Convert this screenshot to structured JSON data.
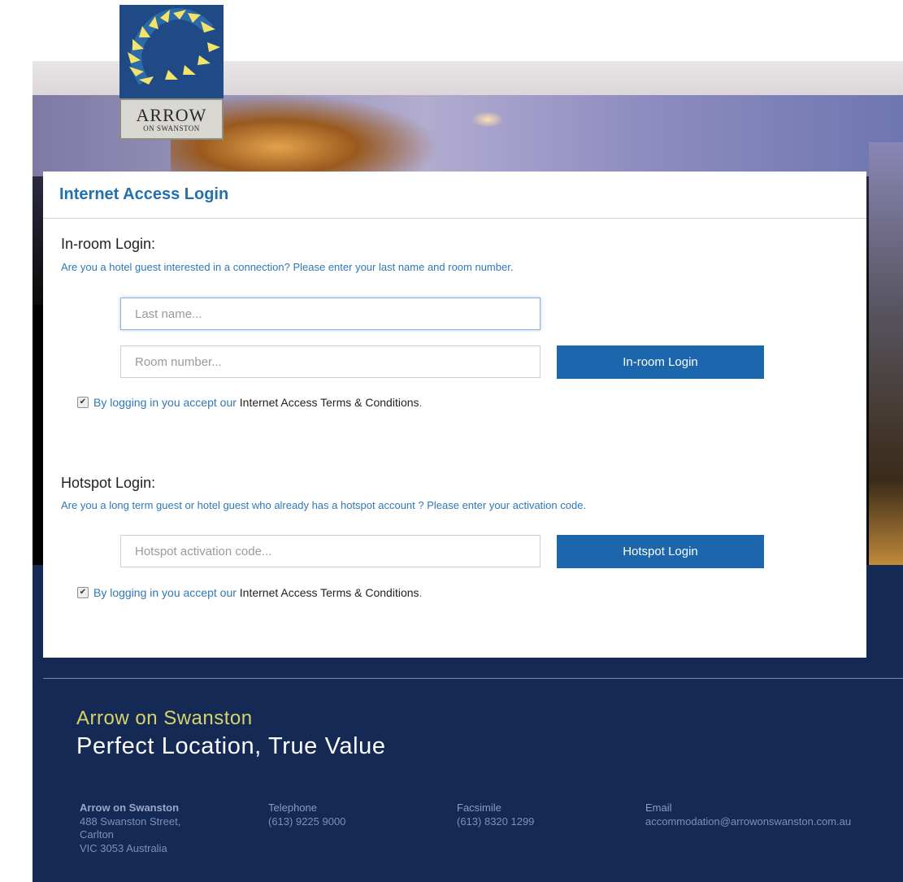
{
  "logo": {
    "word": "ARROW",
    "sub": "ON SWANSTON"
  },
  "panel": {
    "title": "Internet Access Login"
  },
  "inroom": {
    "title": "In-room Login:",
    "description": "Are you a hotel guest interested in a connection? Please enter your last name and room number.",
    "last_name_placeholder": "Last name...",
    "room_number_placeholder": "Room number...",
    "button_label": "In-room Login",
    "terms_prefix": "By logging in you accept our",
    "terms_link": "Internet Access Terms & Conditions",
    "terms_suffix": ".",
    "terms_checked": true
  },
  "hotspot": {
    "title": "Hotspot Login:",
    "description": "Are you a long term guest or hotel guest who already has a hotspot account ? Please enter your activation code.",
    "code_placeholder": "Hotspot activation code...",
    "button_label": "Hotspot Login",
    "terms_prefix": "By logging in you accept our",
    "terms_link": "Internet Access Terms & Conditions",
    "terms_suffix": ".",
    "terms_checked": true
  },
  "footer": {
    "brand": "Arrow on Swanston",
    "tagline": "Perfect Location, True Value",
    "address": {
      "name": "Arrow on Swanston",
      "line1": "488 Swanston Street,",
      "line2": "Carlton",
      "line3": "VIC 3053 Australia"
    },
    "telephone": {
      "label": "Telephone",
      "value": "(613) 9225 9000"
    },
    "facsimile": {
      "label": "Facsimile",
      "value": "(613) 8320 1299"
    },
    "email": {
      "label": "Email",
      "value": "accommodation@arrowonswanston.com.au"
    }
  },
  "colors": {
    "accent": "#1b66ac",
    "title": "#2170b0",
    "footer_bg": "#142a54",
    "footer_brand": "#d7d36a"
  }
}
